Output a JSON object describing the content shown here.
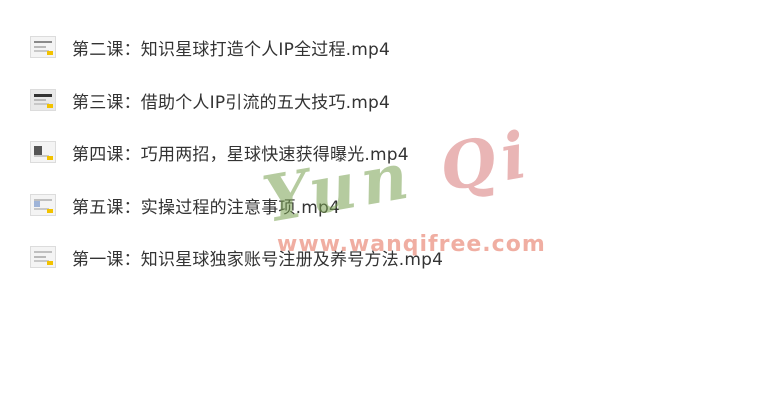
{
  "files": [
    {
      "name": "第二课：知识星球打造个人IP全过程.mp4",
      "icon": "video-thumbnail-icon"
    },
    {
      "name": "第三课：借助个人IP引流的五大技巧.mp4",
      "icon": "video-thumbnail-icon"
    },
    {
      "name": "第四课：巧用两招，星球快速获得曝光.mp4",
      "icon": "video-thumbnail-icon"
    },
    {
      "name": "第五课：实操过程的注意事项.mp4",
      "icon": "video-thumbnail-icon"
    },
    {
      "name": "第一课：知识星球独家账号注册及养号方法.mp4",
      "icon": "video-thumbnail-icon"
    }
  ],
  "watermark": {
    "logo_part1": "Yun",
    "logo_part2": "Qi",
    "url": "www.wanqifree.com"
  },
  "colors": {
    "text": "#333333",
    "background": "#ffffff",
    "watermark_green": "#78a050",
    "watermark_red": "#e67864"
  }
}
